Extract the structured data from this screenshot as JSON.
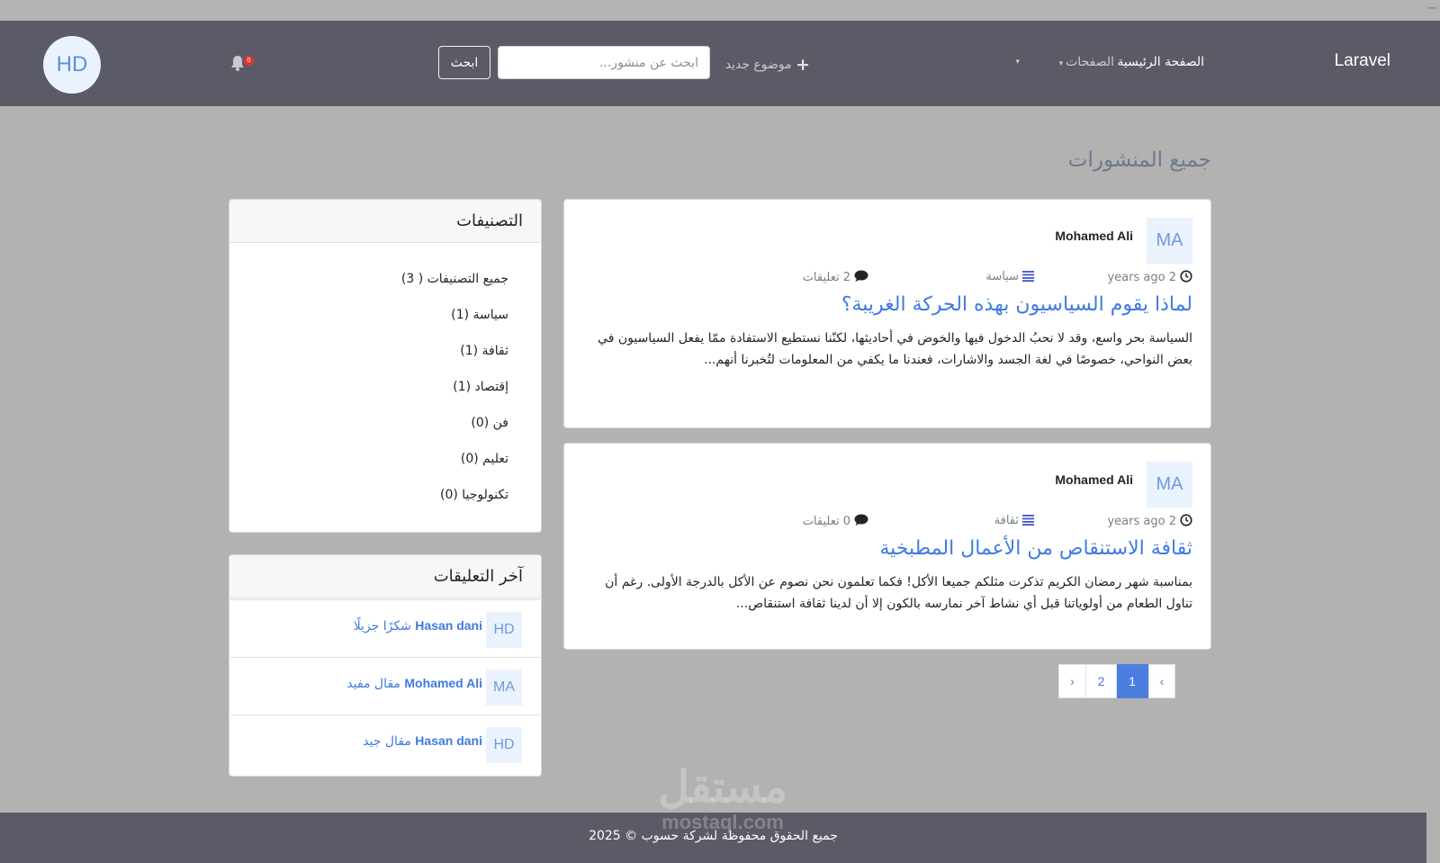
{
  "nav": {
    "brand": "Laravel",
    "home": "الصفحة الرئيسية",
    "pages": "الصفحات",
    "new_post": "موضوع جديد",
    "search_placeholder": "ابحث عن منشور...",
    "search_button": "ابحث",
    "notification_count": "0",
    "user_initials": "HD"
  },
  "page_title": "جميع المنشورات",
  "posts": [
    {
      "initials": "MA",
      "author": "Mohamed Ali",
      "time": "2 years ago",
      "category": "سياسة",
      "comments": "2 تعليقات",
      "title": "لماذا يقوم السياسيون بهذه الحركة الغريبة؟",
      "excerpt": "السياسة بحر واسع، وقد لا نحبُ الدخول فيها والخوض في أحاديثها، لكنّنا نستطيع الاستفادة ممّا يفعل السياسيون في بعض النواحي، خصوصًا في لغة الجسد والاشارات، فعندنا ما يكفي من المعلومات لتُخبرنا أنهم..."
    },
    {
      "initials": "MA",
      "author": "Mohamed Ali",
      "time": "2 years ago",
      "category": "ثقافة",
      "comments": "0 تعليقات",
      "title": "ثقافة الاستنقاص من الأعمال المطبخية",
      "excerpt": "بمناسبة شهر رمضان الكريم تذكرت مثلكم جميعا الأكل! فكما تعلمون نحن نصوم عن الأكل بالدرجة الأولى. رغم أن تناول الطعام من أولوياتنا قبل أي نشاط آخر نمارسه بالكون إلا أن لدينا ثقافة استنقاص..."
    }
  ],
  "pagination": {
    "prev": "‹",
    "pages": [
      "1",
      "2"
    ],
    "next": "›"
  },
  "categories": {
    "title": "التصنيفات",
    "items": [
      "جميع التصنيفات ( 3)",
      "سياسة (1)",
      "ثقافة (1)",
      "إقتصاد (1)",
      "فن (0)",
      "تعليم (0)",
      "تكنولوجيا (0)"
    ]
  },
  "latest_comments": {
    "title": "آخر التعليقات",
    "items": [
      {
        "initials": "HD",
        "name": "Hasan dani",
        "text": "شكرًا جزيلًا"
      },
      {
        "initials": "MA",
        "name": "Mohamed Ali",
        "text": "مقال مفيد"
      },
      {
        "initials": "HD",
        "name": "Hasan dani",
        "text": "مقال جيد"
      }
    ]
  },
  "footer": "جميع الحقوق محفوظة لشركة حسوب © 2025",
  "watermark": {
    "ar": "مستقل",
    "en": "mostaql.com"
  },
  "colors": {
    "navbar": "#5a5b67",
    "link": "#3f7ae0",
    "active_page": "#4a7fe0"
  }
}
